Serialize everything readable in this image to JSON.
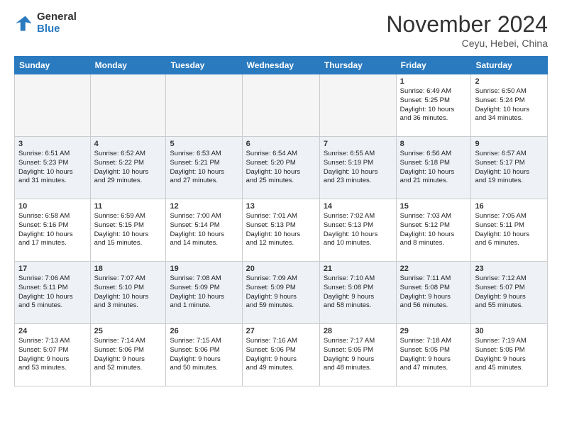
{
  "header": {
    "logo_general": "General",
    "logo_blue": "Blue",
    "month_title": "November 2024",
    "location": "Ceyu, Hebei, China"
  },
  "weekdays": [
    "Sunday",
    "Monday",
    "Tuesday",
    "Wednesday",
    "Thursday",
    "Friday",
    "Saturday"
  ],
  "weeks": [
    [
      {
        "day": "",
        "info": ""
      },
      {
        "day": "",
        "info": ""
      },
      {
        "day": "",
        "info": ""
      },
      {
        "day": "",
        "info": ""
      },
      {
        "day": "",
        "info": ""
      },
      {
        "day": "1",
        "info": "Sunrise: 6:49 AM\nSunset: 5:25 PM\nDaylight: 10 hours\nand 36 minutes."
      },
      {
        "day": "2",
        "info": "Sunrise: 6:50 AM\nSunset: 5:24 PM\nDaylight: 10 hours\nand 34 minutes."
      }
    ],
    [
      {
        "day": "3",
        "info": "Sunrise: 6:51 AM\nSunset: 5:23 PM\nDaylight: 10 hours\nand 31 minutes."
      },
      {
        "day": "4",
        "info": "Sunrise: 6:52 AM\nSunset: 5:22 PM\nDaylight: 10 hours\nand 29 minutes."
      },
      {
        "day": "5",
        "info": "Sunrise: 6:53 AM\nSunset: 5:21 PM\nDaylight: 10 hours\nand 27 minutes."
      },
      {
        "day": "6",
        "info": "Sunrise: 6:54 AM\nSunset: 5:20 PM\nDaylight: 10 hours\nand 25 minutes."
      },
      {
        "day": "7",
        "info": "Sunrise: 6:55 AM\nSunset: 5:19 PM\nDaylight: 10 hours\nand 23 minutes."
      },
      {
        "day": "8",
        "info": "Sunrise: 6:56 AM\nSunset: 5:18 PM\nDaylight: 10 hours\nand 21 minutes."
      },
      {
        "day": "9",
        "info": "Sunrise: 6:57 AM\nSunset: 5:17 PM\nDaylight: 10 hours\nand 19 minutes."
      }
    ],
    [
      {
        "day": "10",
        "info": "Sunrise: 6:58 AM\nSunset: 5:16 PM\nDaylight: 10 hours\nand 17 minutes."
      },
      {
        "day": "11",
        "info": "Sunrise: 6:59 AM\nSunset: 5:15 PM\nDaylight: 10 hours\nand 15 minutes."
      },
      {
        "day": "12",
        "info": "Sunrise: 7:00 AM\nSunset: 5:14 PM\nDaylight: 10 hours\nand 14 minutes."
      },
      {
        "day": "13",
        "info": "Sunrise: 7:01 AM\nSunset: 5:13 PM\nDaylight: 10 hours\nand 12 minutes."
      },
      {
        "day": "14",
        "info": "Sunrise: 7:02 AM\nSunset: 5:13 PM\nDaylight: 10 hours\nand 10 minutes."
      },
      {
        "day": "15",
        "info": "Sunrise: 7:03 AM\nSunset: 5:12 PM\nDaylight: 10 hours\nand 8 minutes."
      },
      {
        "day": "16",
        "info": "Sunrise: 7:05 AM\nSunset: 5:11 PM\nDaylight: 10 hours\nand 6 minutes."
      }
    ],
    [
      {
        "day": "17",
        "info": "Sunrise: 7:06 AM\nSunset: 5:11 PM\nDaylight: 10 hours\nand 5 minutes."
      },
      {
        "day": "18",
        "info": "Sunrise: 7:07 AM\nSunset: 5:10 PM\nDaylight: 10 hours\nand 3 minutes."
      },
      {
        "day": "19",
        "info": "Sunrise: 7:08 AM\nSunset: 5:09 PM\nDaylight: 10 hours\nand 1 minute."
      },
      {
        "day": "20",
        "info": "Sunrise: 7:09 AM\nSunset: 5:09 PM\nDaylight: 9 hours\nand 59 minutes."
      },
      {
        "day": "21",
        "info": "Sunrise: 7:10 AM\nSunset: 5:08 PM\nDaylight: 9 hours\nand 58 minutes."
      },
      {
        "day": "22",
        "info": "Sunrise: 7:11 AM\nSunset: 5:08 PM\nDaylight: 9 hours\nand 56 minutes."
      },
      {
        "day": "23",
        "info": "Sunrise: 7:12 AM\nSunset: 5:07 PM\nDaylight: 9 hours\nand 55 minutes."
      }
    ],
    [
      {
        "day": "24",
        "info": "Sunrise: 7:13 AM\nSunset: 5:07 PM\nDaylight: 9 hours\nand 53 minutes."
      },
      {
        "day": "25",
        "info": "Sunrise: 7:14 AM\nSunset: 5:06 PM\nDaylight: 9 hours\nand 52 minutes."
      },
      {
        "day": "26",
        "info": "Sunrise: 7:15 AM\nSunset: 5:06 PM\nDaylight: 9 hours\nand 50 minutes."
      },
      {
        "day": "27",
        "info": "Sunrise: 7:16 AM\nSunset: 5:06 PM\nDaylight: 9 hours\nand 49 minutes."
      },
      {
        "day": "28",
        "info": "Sunrise: 7:17 AM\nSunset: 5:05 PM\nDaylight: 9 hours\nand 48 minutes."
      },
      {
        "day": "29",
        "info": "Sunrise: 7:18 AM\nSunset: 5:05 PM\nDaylight: 9 hours\nand 47 minutes."
      },
      {
        "day": "30",
        "info": "Sunrise: 7:19 AM\nSunset: 5:05 PM\nDaylight: 9 hours\nand 45 minutes."
      }
    ]
  ]
}
